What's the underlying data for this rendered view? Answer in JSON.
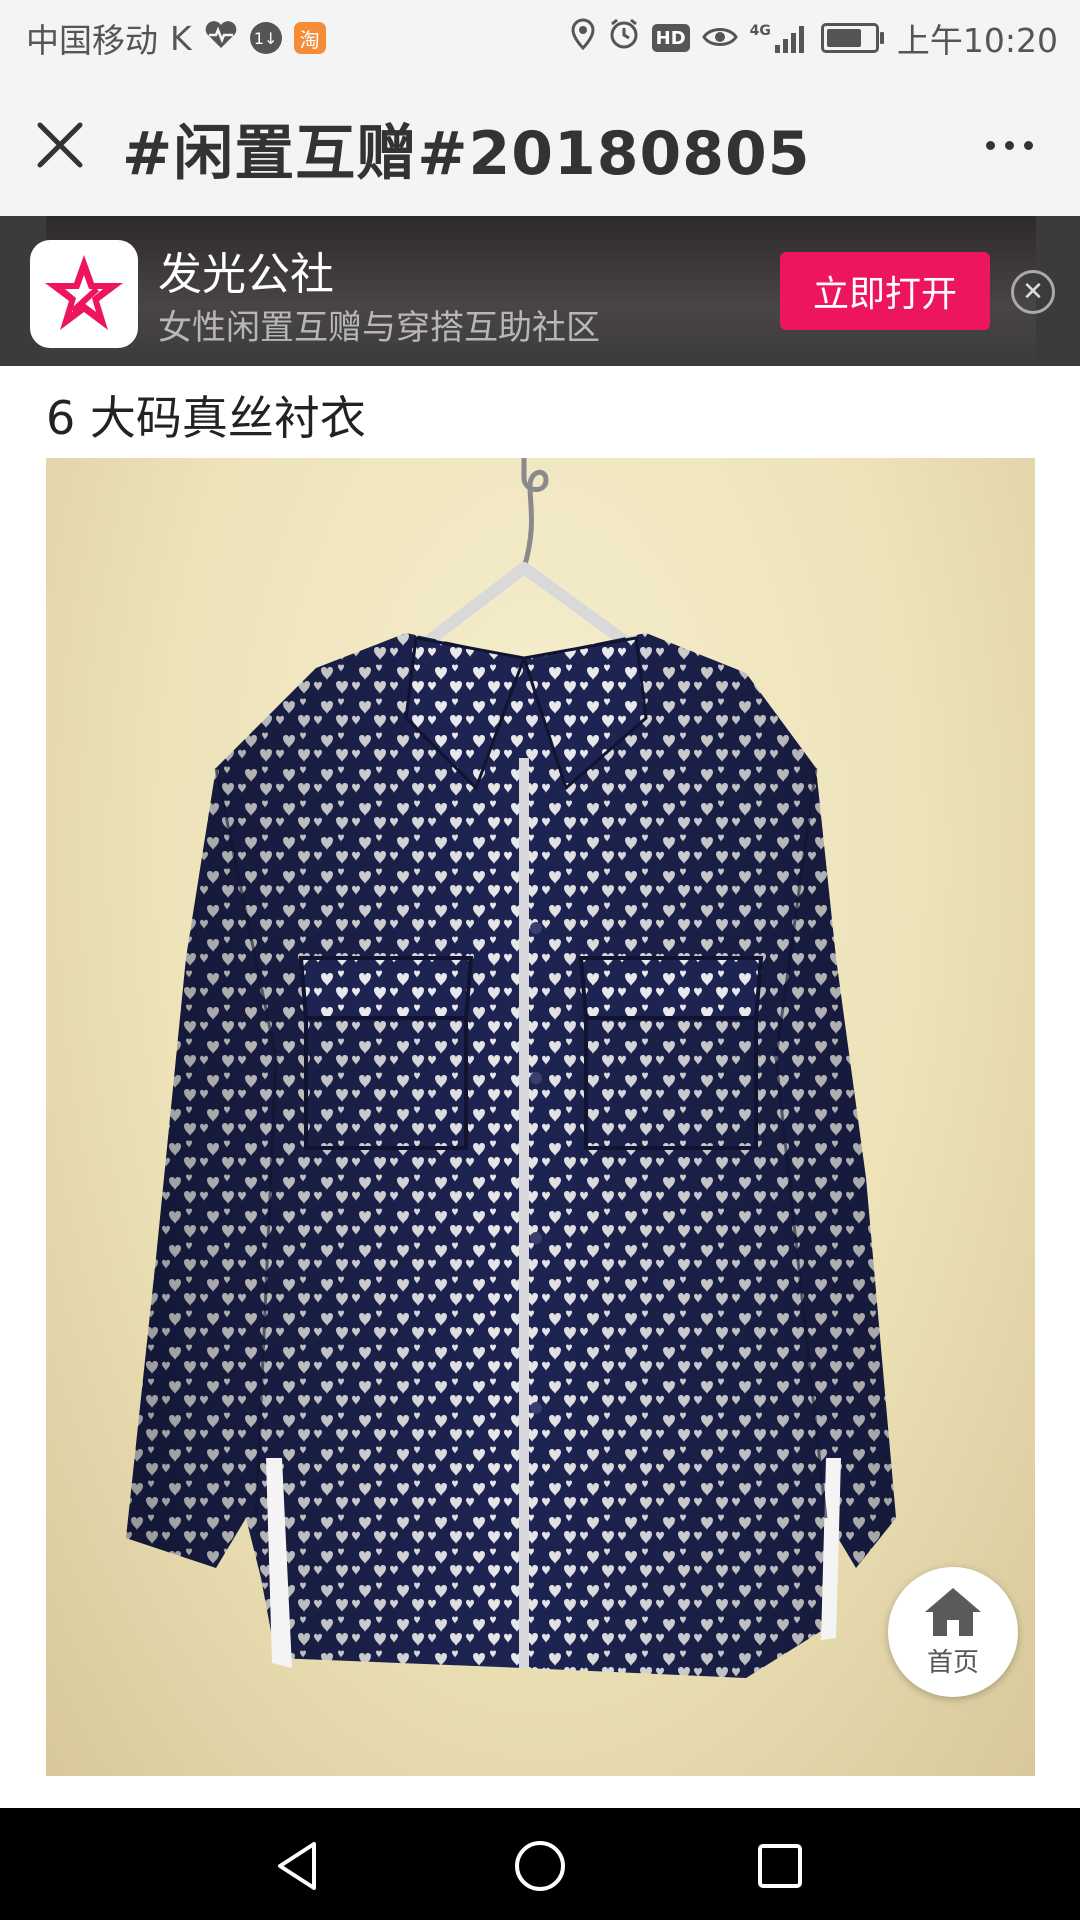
{
  "status_bar": {
    "carrier": "中国移动",
    "carrier_suffix": "K",
    "taobao_badge": "淘",
    "network": "4G",
    "time": "上午10:20",
    "icons": [
      "heart-rate-icon",
      "data-saver-icon",
      "taobao-icon",
      "location-icon",
      "alarm-icon",
      "hd-icon",
      "eye-icon",
      "signal-icon",
      "battery-icon"
    ]
  },
  "header": {
    "title": "#闲置互赠#20180805",
    "close_icon": "close-icon",
    "more_icon": "more-dots-icon"
  },
  "banner": {
    "app_name": "发光公社",
    "app_desc": "女性闲置互赠与穿搭互助社区",
    "open_label": "立即打开",
    "close_icon": "close-circle-icon",
    "accent_color": "#ee1560"
  },
  "post": {
    "item_title": "6 大码真丝衬衣",
    "photo_subject": "navy-heart-print-shirt-on-hanger"
  },
  "fab": {
    "home_label": "首页",
    "home_icon": "home-icon"
  },
  "nav": {
    "icons": [
      "back-triangle-icon",
      "home-circle-icon",
      "recents-square-icon"
    ]
  }
}
